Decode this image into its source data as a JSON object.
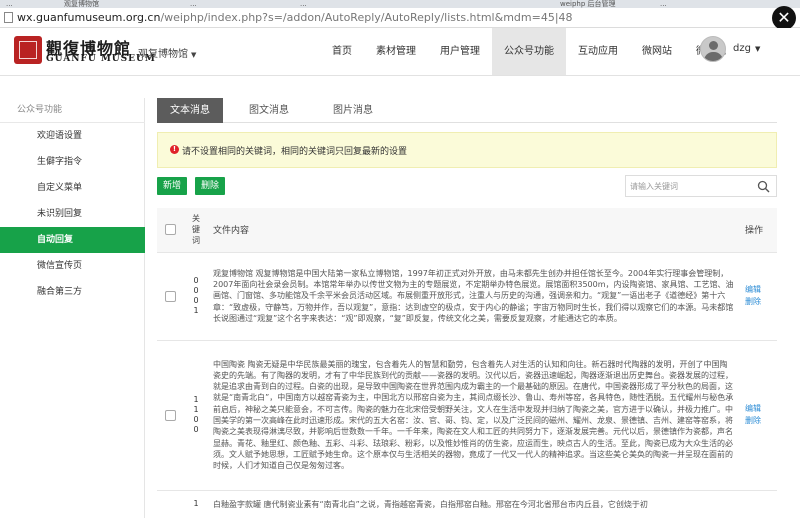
{
  "browser": {
    "url_host": "wx.guanfumuseum.org.cn",
    "url_path": "/weiphp/index.php?s=/addon/AutoReply/AutoReply/lists.html&mdm=45|48",
    "tabs": [
      "...",
      "观复博物馆",
      "...",
      "...",
      "weiphp 后台管理",
      "..."
    ]
  },
  "header": {
    "logo_cn": "觀復博物館",
    "logo_en": "GUANFU MUSEUM",
    "account": "观复博物馆",
    "nav": [
      "首页",
      "素材管理",
      "用户管理",
      "公众号功能",
      "互动应用",
      "微网站",
      "微商城"
    ],
    "active_nav": 3,
    "username": "dzg"
  },
  "sidebar": {
    "title": "公众号功能",
    "items": [
      "欢迎语设置",
      "生僻字指令",
      "自定义菜单",
      "未识别回复",
      "自动回复",
      "微信宣传页",
      "融合第三方"
    ],
    "active": 4
  },
  "content": {
    "tabs": [
      "文本消息",
      "图文消息",
      "图片消息"
    ],
    "active_tab": 0,
    "alert": "请不设置相同的关键词，相同的关键词只回复最新的设置",
    "btn_add": "新增",
    "btn_delete": "删除",
    "search_placeholder": "请输入关键词",
    "table": {
      "headers": {
        "keyword": "关键词",
        "content": "文件内容",
        "op": "操作"
      },
      "rows": [
        {
          "keyword": "0\n0\n0\n1",
          "content": "观复博物馆 观复博物馆是中国大陆第一家私立博物馆，1997年初正式对外开放，由马未都先生创办并担任馆长至今。2004年实行理事会管理制，2007年面向社会录会员制。本馆常年举办以传世文物为主的专题展览，不定期举办特色展览。展馆面积3500m，内设陶瓷馆、家具馆、工艺馆、油画馆、门窗馆、多功能馆及千余平米会员活动区域。布展侧重开放形式，注重人与历史的沟通，强调亲和力。“观复”一语出老子《道德经》第十六章：“致虚极，守静笃，万物并作，吾以观复”，意指：达到虚空的极点，安于内心的静谧；宇宙万物同时生长，我们得以观察它们的本源。马未都馆长说图通过“观复”这个名字来表达：“观”即观察，“复”即反复，传统文化之美，需要反复观察，才能通达它的本质。",
          "edit": "编辑",
          "delete": "删除"
        },
        {
          "keyword": "1\n1\n0\n0",
          "content": "中国陶瓷 陶瓷无疑是中华民族最美丽的瑰宝，包含着先人的智慧和勤劳，包含着先人对生活的认知和向往。新石器时代陶器的发明，开创了中国陶瓷史的先端。有了陶器的发明，才有了中华民族到代的贡献——瓷器的发明。汉代以后，瓷器迅速崛起，陶器逐渐退出历史舞台。瓷器发展的过程，就是追求由青到白的过程。白瓷的出现，是导致中国陶瓷在世界范围内成为霸主的一个最基础的原因。在唐代，中国瓷器形成了平分秋色的局面，这就是“南青北白”，中国南方以越窑青瓷为主，中国北方以邢窑白瓷为主，其间点缀长沙、鲁山、寿州等窑，各具特色，随性洒脱。五代耀州与秘色承前启后，神秘之美只能意会，不可言传。陶瓷的魅力在北宋倍受朝野关注，文人在生活中发现并归纳了陶瓷之美，官方进于以确认，并极力推广。中国美学的第一次高峰在此时迅速形成。宋代的五大名窑：汝、官、哥、钧、定，以及广泛民间的磁州、耀州、龙泉、景德镇、吉州、建窑等窑系，将陶瓷之美表现得淋漓尽致，并影响后世数数一千年。一千年来，陶瓷在文人和工匠的共同努力下，逐渐发展完善。元代以后，景德镇作为瓷都，声名显赫。青花、釉里红、颜色釉、五彩、斗彩、珐琅彩、粉彩，以及惟妙惟肖的仿生瓷，应运而生，映点古人的生活。至此，陶瓷已成为大众生活的必须。文人赋予她思想，工匠赋予她生命。这个原本仅与生活相关的器物，竟成了一代又一代人的精神追求。当这些美仑美奂的陶瓷一并呈现在面前的时候，人们才知道自己仅是匆匆过客。",
          "edit": "编辑",
          "delete": "删除"
        },
        {
          "keyword": "1",
          "content": "白釉盈字款罐 唐代制瓷业素有“南青北白”之说，青指越窑青瓷，白指邢窑白釉。邢窑在今河北省邢台市内丘县，它创烧于初",
          "edit": "",
          "delete": ""
        }
      ]
    }
  }
}
